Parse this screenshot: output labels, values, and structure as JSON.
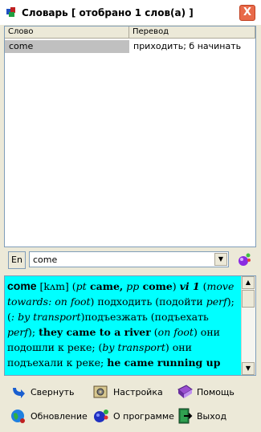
{
  "window": {
    "title": "Словарь [ отобрано 1 слов(а) ]",
    "close_label": "X"
  },
  "list": {
    "columns": [
      "Слово",
      "Перевод"
    ],
    "rows": [
      {
        "word": "come",
        "translation": "приходить; б начинать"
      }
    ]
  },
  "search": {
    "lang": "En",
    "value": "come"
  },
  "article": {
    "headword": "come",
    "segments": [
      {
        "t": " [kʌm] (",
        "s": "n"
      },
      {
        "t": "pt",
        "s": "i"
      },
      {
        "t": " came,",
        "s": "b"
      },
      {
        "t": " ",
        "s": "n"
      },
      {
        "t": "pp",
        "s": "i"
      },
      {
        "t": " come",
        "s": "b"
      },
      {
        "t": ") ",
        "s": "n"
      },
      {
        "t": "vi 1",
        "s": "bi"
      },
      {
        "t": " (",
        "s": "n"
      },
      {
        "t": "move towards: on foot",
        "s": "i"
      },
      {
        "t": ") подходить (подойти ",
        "s": "n"
      },
      {
        "t": "perf",
        "s": "i"
      },
      {
        "t": "); (",
        "s": "n"
      },
      {
        "t": ": by transport",
        "s": "i"
      },
      {
        "t": ")подъезжать (подъехать ",
        "s": "n"
      },
      {
        "t": "perf",
        "s": "i"
      },
      {
        "t": "); ",
        "s": "n"
      },
      {
        "t": "they came to a river",
        "s": "b"
      },
      {
        "t": " (",
        "s": "n"
      },
      {
        "t": "on foot",
        "s": "i"
      },
      {
        "t": ") они подошли к реке; (",
        "s": "n"
      },
      {
        "t": "by transport",
        "s": "i"
      },
      {
        "t": ") они подъехали к реке; ",
        "s": "n"
      },
      {
        "t": "he came running up",
        "s": "b"
      }
    ]
  },
  "toolbar": {
    "collapse": "Свернуть",
    "settings": "Настройка",
    "help": "Помощь",
    "update": "Обновление",
    "about": "О программе",
    "exit": "Выход"
  }
}
